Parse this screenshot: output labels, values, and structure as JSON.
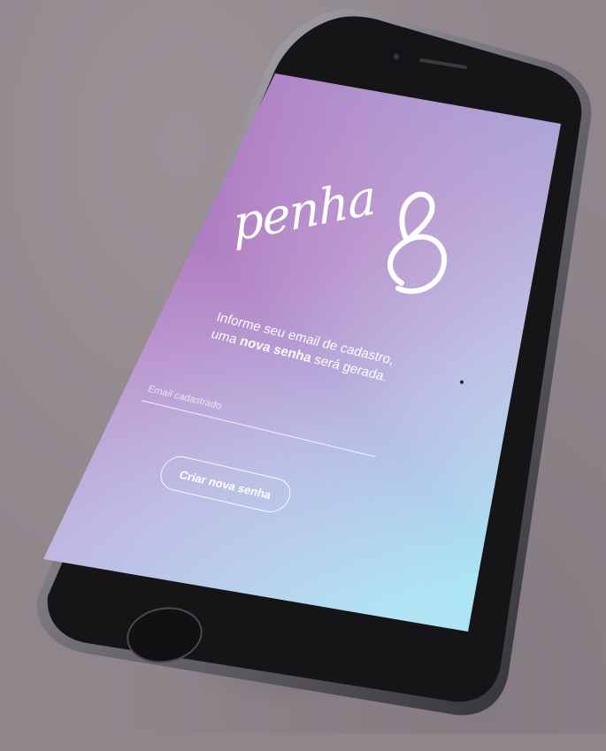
{
  "app": {
    "logo_text": "penha"
  },
  "recovery": {
    "line1": "Informe seu email de cadastro,",
    "line2_prefix": "uma ",
    "line2_bold": "nova senha",
    "line2_suffix": " será gerada."
  },
  "email_input": {
    "value": "",
    "placeholder": "Email cadastrado"
  },
  "create_button": {
    "label": "Criar nova senha"
  },
  "colors": {
    "background": "#8f868c",
    "screen_gradient_top": "#a467b8",
    "screen_gradient_bottom": "#a9e3f3",
    "device_body": "#141416",
    "text": "#ffffff"
  }
}
